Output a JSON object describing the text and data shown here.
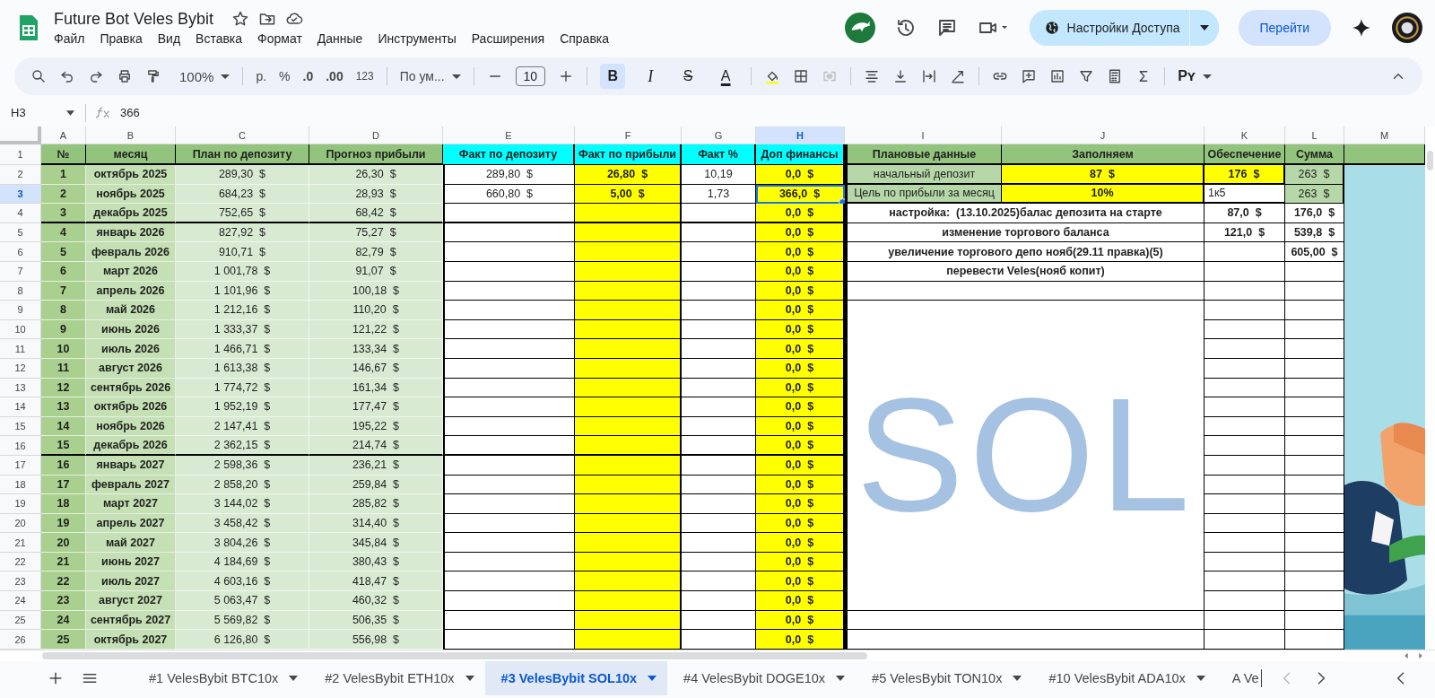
{
  "app": {
    "title": "Future Bot Veles  Bybit",
    "menu": [
      "Файл",
      "Правка",
      "Вид",
      "Вставка",
      "Формат",
      "Данные",
      "Инструменты",
      "Расширения",
      "Справка"
    ]
  },
  "header_actions": {
    "share_button": "Настройки Доступа",
    "go_button": "Перейти"
  },
  "toolbar": {
    "zoom": "100%",
    "currency": "р.",
    "percent": "%",
    "decrease_decimals": ".0",
    "increase_decimals": ".00",
    "number_format": "123",
    "font": "По ум...",
    "font_size": "10",
    "format_buttons": [
      {
        "kind": "bold",
        "label": "B",
        "selected": true
      },
      {
        "kind": "italic",
        "label": "I",
        "selected": false
      },
      {
        "kind": "strike",
        "label": "S",
        "selected": false
      },
      {
        "kind": "color",
        "label": "A",
        "selected": false
      }
    ],
    "input_tools": "Pʏ"
  },
  "formula_bar": {
    "cell": "H3",
    "value": "366"
  },
  "columns": [
    {
      "label": "A",
      "selected": false
    },
    {
      "label": "B",
      "selected": false
    },
    {
      "label": "C",
      "selected": false
    },
    {
      "label": "D",
      "selected": false
    },
    {
      "label": "E",
      "selected": false
    },
    {
      "label": "F",
      "selected": false
    },
    {
      "label": "G",
      "selected": false
    },
    {
      "label": "H",
      "selected": true
    },
    {
      "label": "I",
      "selected": false
    },
    {
      "label": "J",
      "selected": false
    },
    {
      "label": "K",
      "selected": false
    },
    {
      "label": "L",
      "selected": false
    },
    {
      "label": "M",
      "selected": false
    }
  ],
  "row_numbers": [
    {
      "label": "1",
      "selected": false
    },
    {
      "label": "2",
      "selected": false
    },
    {
      "label": "3",
      "selected": true
    },
    {
      "label": "4",
      "selected": false
    },
    {
      "label": "5",
      "selected": false
    },
    {
      "label": "6",
      "selected": false
    },
    {
      "label": "7",
      "selected": false
    },
    {
      "label": "8",
      "selected": false
    },
    {
      "label": "9",
      "selected": false
    },
    {
      "label": "10",
      "selected": false
    },
    {
      "label": "11",
      "selected": false
    },
    {
      "label": "12",
      "selected": false
    },
    {
      "label": "13",
      "selected": false
    },
    {
      "label": "14",
      "selected": false
    },
    {
      "label": "15",
      "selected": false
    },
    {
      "label": "16",
      "selected": false
    },
    {
      "label": "17",
      "selected": false
    },
    {
      "label": "18",
      "selected": false
    },
    {
      "label": "19",
      "selected": false
    },
    {
      "label": "20",
      "selected": false
    },
    {
      "label": "21",
      "selected": false
    },
    {
      "label": "22",
      "selected": false
    },
    {
      "label": "23",
      "selected": false
    },
    {
      "label": "24",
      "selected": false
    },
    {
      "label": "25",
      "selected": false
    },
    {
      "label": "26",
      "selected": false
    }
  ],
  "months": {
    "headers": [
      "№",
      "месяц",
      "План по депозиту",
      "Прогноз прибыли",
      "Факт по депозиту",
      "Факт по прибыли",
      "Факт %",
      "Доп финансы"
    ],
    "rows": [
      {
        "no": "1",
        "month": "октябрь 2025",
        "plan": "289,30  $",
        "forecast": "26,30  $",
        "fact_deposit": "289,80  $",
        "fact_profit": "26,80  $",
        "fact_percent": "10,19",
        "extra_funds": "0,0  $",
        "extra_selected": false
      },
      {
        "no": "2",
        "month": "ноябрь 2025",
        "plan": "684,23  $",
        "forecast": "28,93  $",
        "fact_deposit": "660,80  $",
        "fact_profit": "5,00  $",
        "fact_percent": "1,73",
        "extra_funds": "366,0  $",
        "extra_selected": true
      },
      {
        "no": "3",
        "month": "декабрь 2025",
        "plan": "752,65  $",
        "forecast": "68,42  $",
        "extra_funds": "0,0  $",
        "extra_selected": false
      },
      {
        "no": "4",
        "month": "январь 2026",
        "plan": "827,92  $",
        "forecast": "75,27  $",
        "extra_funds": "0,0  $",
        "extra_selected": false
      },
      {
        "no": "5",
        "month": "февраль 2026",
        "plan": "910,71  $",
        "forecast": "82,79  $",
        "extra_funds": "0,0  $",
        "extra_selected": false
      },
      {
        "no": "6",
        "month": "март 2026",
        "plan": "1 001,78  $",
        "forecast": "91,07  $",
        "extra_funds": "0,0  $",
        "extra_selected": false
      },
      {
        "no": "7",
        "month": "апрель 2026",
        "plan": "1 101,96  $",
        "forecast": "100,18  $",
        "extra_funds": "0,0  $",
        "extra_selected": false
      },
      {
        "no": "8",
        "month": "май 2026",
        "plan": "1 212,16  $",
        "forecast": "110,20  $",
        "extra_funds": "0,0  $",
        "extra_selected": false
      },
      {
        "no": "9",
        "month": "июнь 2026",
        "plan": "1 333,37  $",
        "forecast": "121,22  $",
        "extra_funds": "0,0  $",
        "extra_selected": false
      },
      {
        "no": "10",
        "month": "июль 2026",
        "plan": "1 466,71  $",
        "forecast": "133,34  $",
        "extra_funds": "0,0  $",
        "extra_selected": false
      },
      {
        "no": "11",
        "month": "август 2026",
        "plan": "1 613,38  $",
        "forecast": "146,67  $",
        "extra_funds": "0,0  $",
        "extra_selected": false
      },
      {
        "no": "12",
        "month": "сентябрь 2026",
        "plan": "1 774,72  $",
        "forecast": "161,34  $",
        "extra_funds": "0,0  $",
        "extra_selected": false
      },
      {
        "no": "13",
        "month": "октябрь 2026",
        "plan": "1 952,19  $",
        "forecast": "177,47  $",
        "extra_funds": "0,0  $",
        "extra_selected": false
      },
      {
        "no": "14",
        "month": "ноябрь 2026",
        "plan": "2 147,41  $",
        "forecast": "195,22  $",
        "extra_funds": "0,0  $",
        "extra_selected": false
      },
      {
        "no": "15",
        "month": "декабрь 2026",
        "plan": "2 362,15  $",
        "forecast": "214,74  $",
        "extra_funds": "0,0  $",
        "extra_selected": false
      },
      {
        "no": "16",
        "month": "январь 2027",
        "plan": "2 598,36  $",
        "forecast": "236,21  $",
        "extra_funds": "0,0  $",
        "extra_selected": false
      },
      {
        "no": "17",
        "month": "февраль 2027",
        "plan": "2 858,20  $",
        "forecast": "259,84  $",
        "extra_funds": "0,0  $",
        "extra_selected": false
      },
      {
        "no": "18",
        "month": "март 2027",
        "plan": "3 144,02  $",
        "forecast": "285,82  $",
        "extra_funds": "0,0  $",
        "extra_selected": false
      },
      {
        "no": "19",
        "month": "апрель 2027",
        "plan": "3 458,42  $",
        "forecast": "314,40  $",
        "extra_funds": "0,0  $",
        "extra_selected": false
      },
      {
        "no": "20",
        "month": "май 2027",
        "plan": "3 804,26  $",
        "forecast": "345,84  $",
        "extra_funds": "0,0  $",
        "extra_selected": false
      },
      {
        "no": "21",
        "month": "июнь 2027",
        "plan": "4 184,69  $",
        "forecast": "380,43  $",
        "extra_funds": "0,0  $",
        "extra_selected": false
      },
      {
        "no": "22",
        "month": "июль 2027",
        "plan": "4 603,16  $",
        "forecast": "418,47  $",
        "extra_funds": "0,0  $",
        "extra_selected": false
      },
      {
        "no": "23",
        "month": "август 2027",
        "plan": "5 063,47  $",
        "forecast": "460,32  $",
        "extra_funds": "0,0  $",
        "extra_selected": false
      },
      {
        "no": "24",
        "month": "сентябрь 2027",
        "plan": "5 569,82  $",
        "forecast": "506,35  $",
        "extra_funds": "0,0  $",
        "extra_selected": false
      },
      {
        "no": "25",
        "month": "октябрь 2027",
        "plan": "6 126,80  $",
        "forecast": "556,98  $",
        "extra_funds": "0,0  $",
        "extra_selected": false
      }
    ]
  },
  "summary": {
    "headers": [
      "Плановые данные",
      "Заполняем",
      "Обеспечение",
      "Сумма"
    ],
    "rows": [
      {
        "kind": "input",
        "label": "начальный депозит",
        "fill": "87  $",
        "security": "176  $",
        "security_highlight": true,
        "sum": "263  $"
      },
      {
        "kind": "input",
        "label": "Цель по прибыли за месяц",
        "fill": "10%",
        "security": "1к5",
        "security_highlight": false,
        "sum": "263  $"
      },
      {
        "kind": "note",
        "label": "настройка:  (13.10.2025)балас депозита на старте",
        "security": "87,0  $",
        "sum": "176,0  $"
      },
      {
        "kind": "note",
        "label": "изменение торгового баланса",
        "security": "121,0  $",
        "sum": "539,8  $"
      },
      {
        "kind": "note",
        "label": "увеличение торгового депо нояб(29.11 правка)(5)",
        "sum": "605,00  $"
      },
      {
        "kind": "note",
        "label": "перевести Veles(нояб копит)"
      }
    ]
  },
  "handwriting": "SOL",
  "sheet_tabs": [
    {
      "label": "#1 VelesBybit BTC10x",
      "selected": false
    },
    {
      "label": "#2 VelesBybit ETH10x",
      "selected": false
    },
    {
      "label": "#3 VelesBybit SOL10x",
      "selected": true
    },
    {
      "label": "#4 VelesBybit DOGE10x",
      "selected": false
    },
    {
      "label": "#5 VelesBybit TON10x",
      "selected": false
    },
    {
      "label": "#10 VelesBybit ADA10x",
      "selected": false
    },
    {
      "label": "A Ve",
      "selected": false
    }
  ]
}
